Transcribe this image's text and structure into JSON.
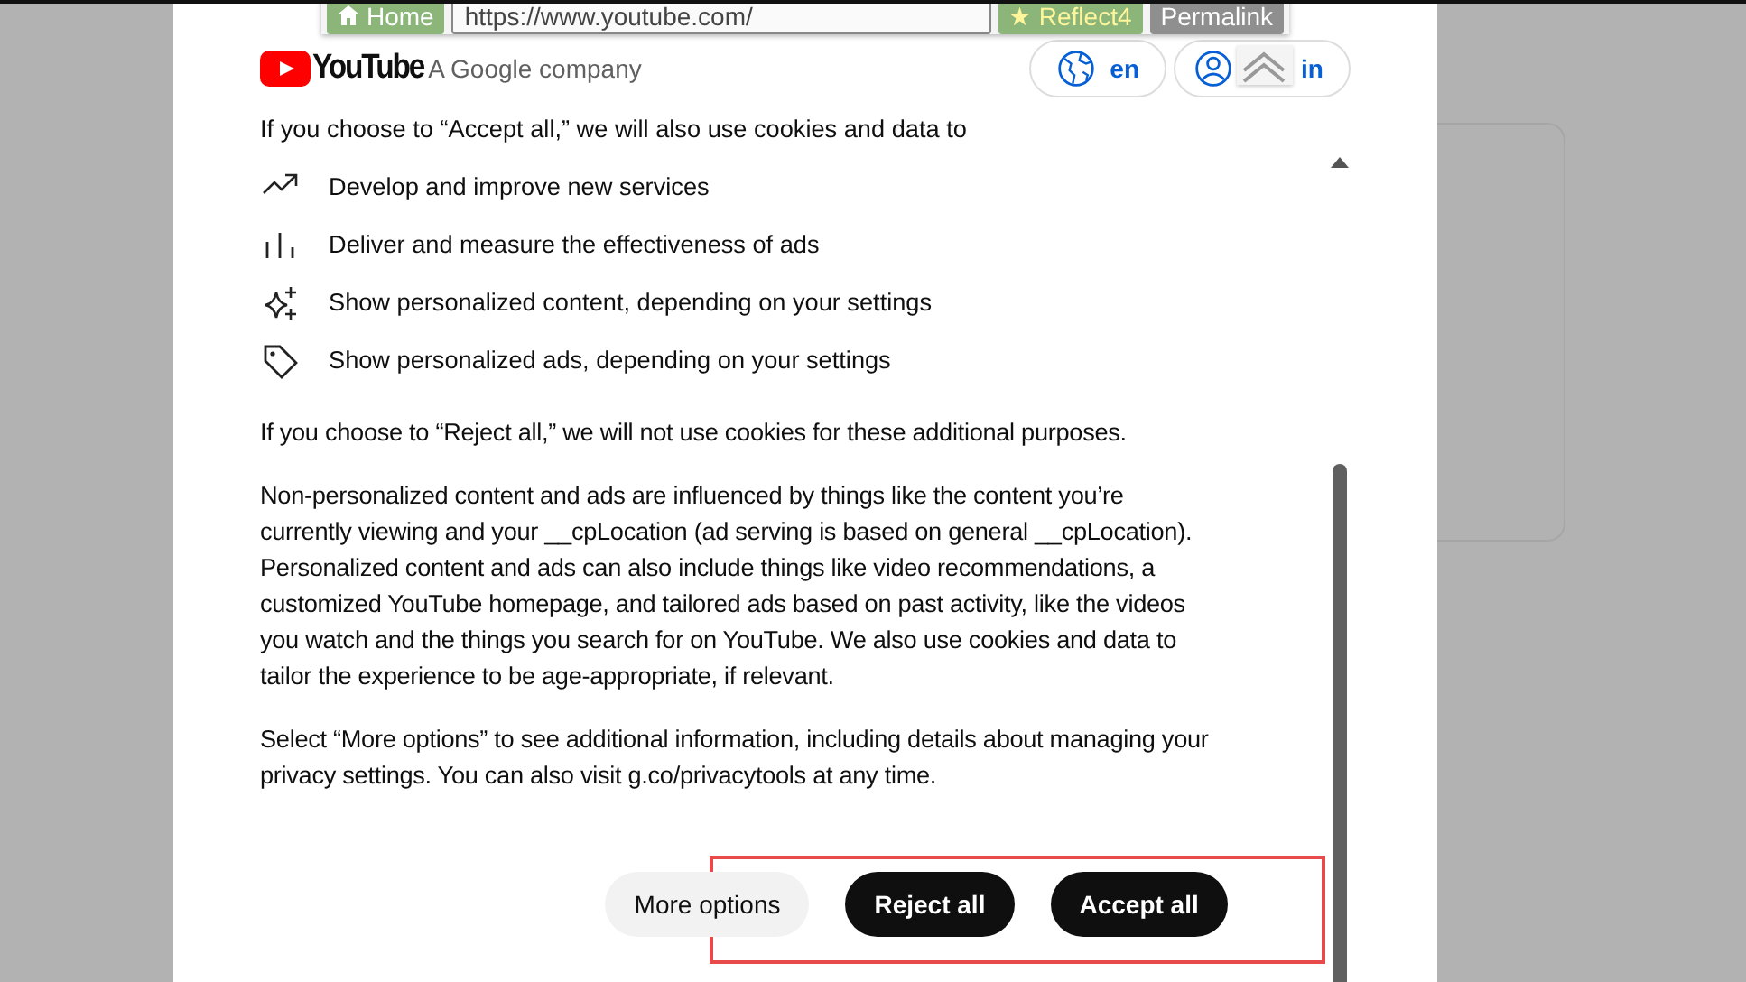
{
  "toolbar": {
    "home": "Home",
    "url": "https://www.youtube.com/",
    "reflect": "★ Reflect4",
    "permalink": "Permalink"
  },
  "header": {
    "logo": "YouTube",
    "subtitle": "A Google company",
    "language": "en",
    "sign_in": "in"
  },
  "intro": "If you choose to “Accept all,” we will also use cookies and data to",
  "purposes": [
    {
      "kind": "trend",
      "text": "Develop and improve new services"
    },
    {
      "kind": "bars",
      "text": "Deliver and measure the effectiveness of ads"
    },
    {
      "kind": "sparkle",
      "text": "Show personalized content, depending on your settings"
    },
    {
      "kind": "tag",
      "text": "Show personalized ads, depending on your settings"
    }
  ],
  "paragraphs": [
    "If you choose to “Reject all,” we will not use cookies for these additional purposes.",
    "Non-personalized content and ads are influenced by things like the content you’re currently viewing and your __cpLocation (ad serving is based on general __cpLocation). Personalized content and ads can also include things like video recommendations, a customized YouTube homepage, and tailored ads based on past activity, like the videos you watch and the things you search for on YouTube. We also use cookies and data to tailor the experience to be age-appropriate, if relevant.",
    "Select “More options” to see additional information, including details about managing your privacy settings. You can also visit g.co/privacytools at any time."
  ],
  "buttons": [
    {
      "kind": "secondary",
      "label": "More options"
    },
    {
      "kind": "primary",
      "label": "Reject all"
    },
    {
      "kind": "primary",
      "label": "Accept all"
    }
  ]
}
